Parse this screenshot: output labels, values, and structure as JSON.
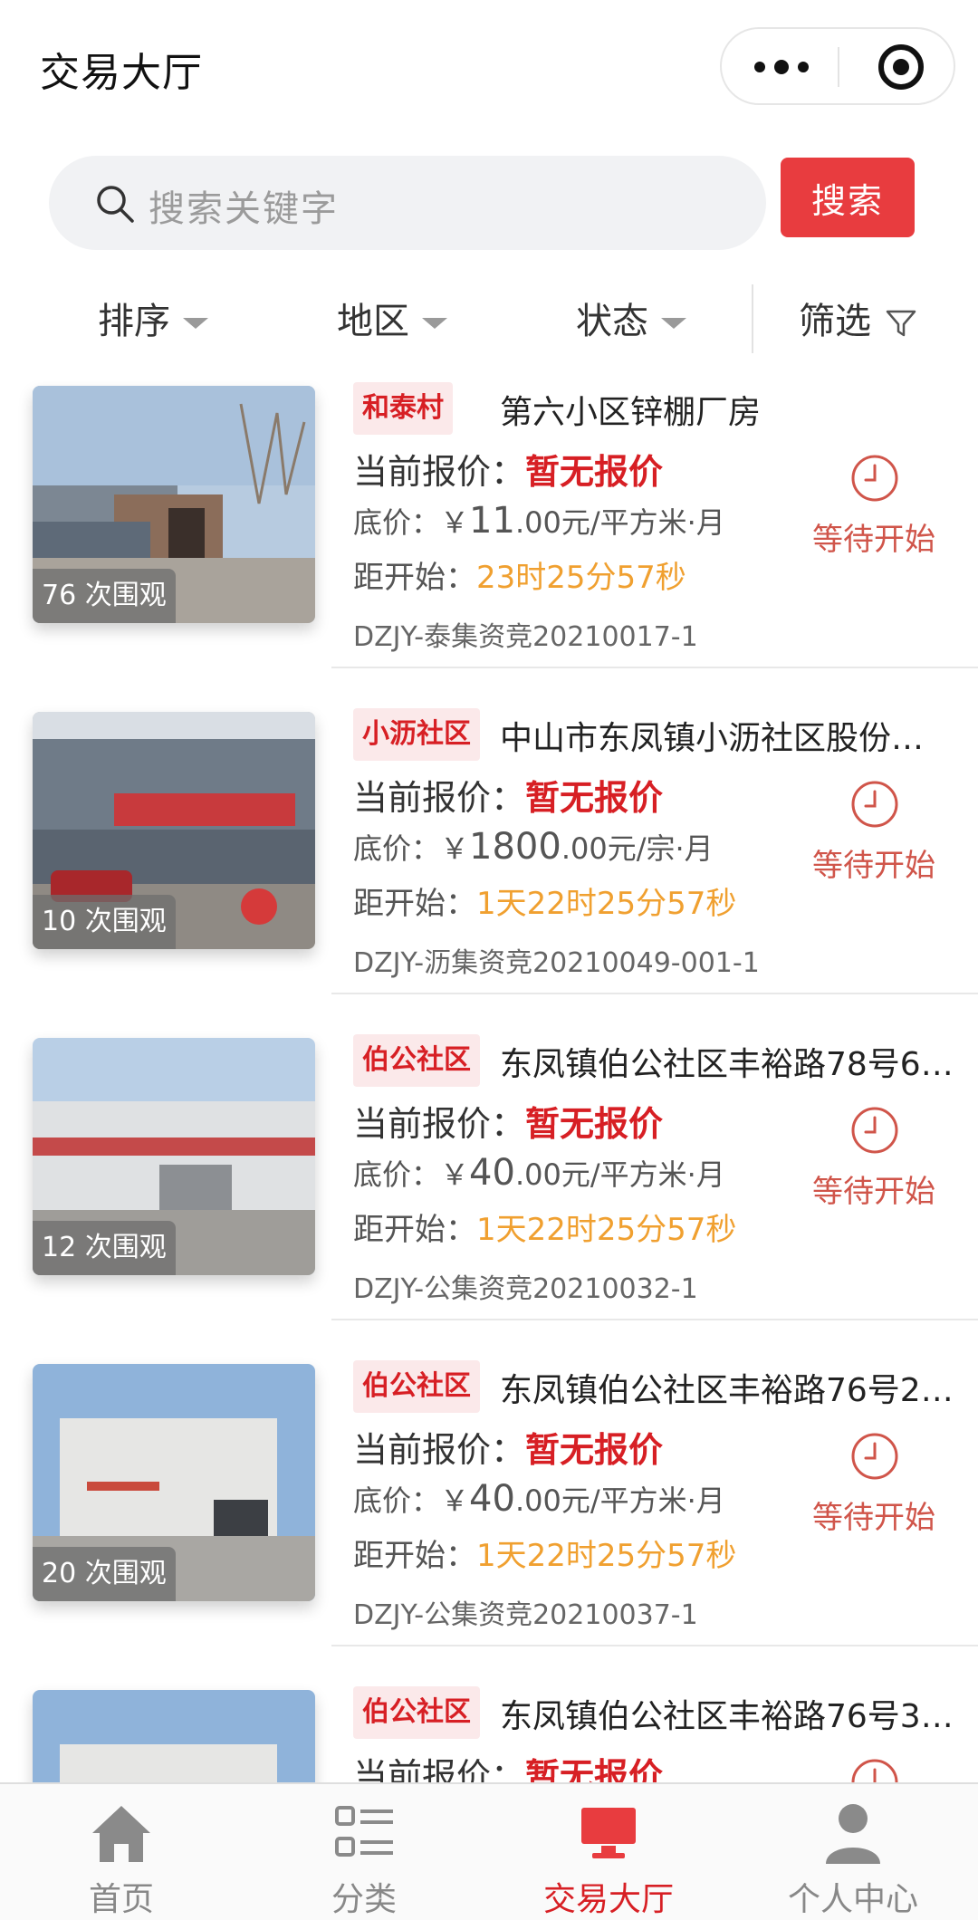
{
  "header": {
    "title": "交易大厅"
  },
  "search": {
    "placeholder": "搜索关键字",
    "button_label": "搜索"
  },
  "filters": [
    {
      "label": "排序"
    },
    {
      "label": "地区"
    },
    {
      "label": "状态"
    },
    {
      "label": "筛选"
    }
  ],
  "listings": [
    {
      "tag": "和泰村",
      "name": "第六小区锌棚厂房",
      "views": "76 次围观",
      "offer_label": "当前报价：",
      "offer_value": "暂无报价",
      "base_label": "底价：",
      "price_sign": "￥",
      "price_int": "11",
      "price_rest": ".00元/平方米·月",
      "countdown_label": "距开始：",
      "countdown": "23时25分57秒",
      "code": "DZJY-泰集资竞20210017-1",
      "status": "等待开始"
    },
    {
      "tag": "小沥社区",
      "name": "中山市东凤镇小沥社区股份…",
      "views": "10 次围观",
      "offer_label": "当前报价：",
      "offer_value": "暂无报价",
      "base_label": "底价：",
      "price_sign": "￥",
      "price_int": "1800",
      "price_rest": ".00元/宗·月",
      "countdown_label": "距开始：",
      "countdown": "1天22时25分57秒",
      "code": "DZJY-沥集资竞20210049-001-1",
      "status": "等待开始"
    },
    {
      "tag": "伯公社区",
      "name": "东凤镇伯公社区丰裕路78号6…",
      "views": "12 次围观",
      "offer_label": "当前报价：",
      "offer_value": "暂无报价",
      "base_label": "底价：",
      "price_sign": "￥",
      "price_int": "40",
      "price_rest": ".00元/平方米·月",
      "countdown_label": "距开始：",
      "countdown": "1天22时25分57秒",
      "code": "DZJY-公集资竞20210032-1",
      "status": "等待开始"
    },
    {
      "tag": "伯公社区",
      "name": "东凤镇伯公社区丰裕路76号2…",
      "views": "20 次围观",
      "offer_label": "当前报价：",
      "offer_value": "暂无报价",
      "base_label": "底价：",
      "price_sign": "￥",
      "price_int": "40",
      "price_rest": ".00元/平方米·月",
      "countdown_label": "距开始：",
      "countdown": "1天22时25分57秒",
      "code": "DZJY-公集资竞20210037-1",
      "status": "等待开始"
    },
    {
      "tag": "伯公社区",
      "name": "东凤镇伯公社区丰裕路76号3…",
      "offer_label": "当前报价：",
      "offer_value": "暂无报价"
    }
  ],
  "tabbar": [
    {
      "label": "首页",
      "icon": "home-icon"
    },
    {
      "label": "分类",
      "icon": "category-icon"
    },
    {
      "label": "交易大厅",
      "icon": "monitor-icon",
      "active": true
    },
    {
      "label": "个人中心",
      "icon": "user-icon"
    }
  ],
  "colors": {
    "accent": "#e83c3f",
    "tag_text": "#d71f24",
    "countdown": "#f0a030",
    "status": "#d0554a"
  }
}
